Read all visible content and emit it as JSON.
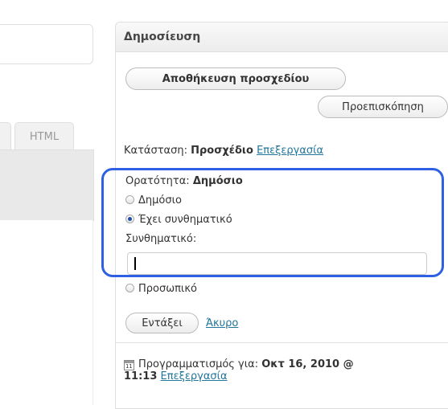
{
  "editor": {
    "html_tab_label": "HTML"
  },
  "publish": {
    "header": "Δημοσίευση",
    "save_draft": "Αποθήκευση προσχεδίου",
    "preview": "Προεπισκόπηση",
    "status_label": "Κατάσταση: ",
    "status_value": "Προσχέδιο",
    "status_edit": "Επεξεργασία",
    "visibility_label": "Ορατότητα: ",
    "visibility_value": "Δημόσιο",
    "options": {
      "public": "Δημόσιο",
      "password": "Έχει συνθηματικό",
      "private": "Προσωπικό"
    },
    "selected_option": "password",
    "password_label": "Συνθηματικό:",
    "password_value": "",
    "ok": "Εντάξει",
    "cancel": "Άκυρο",
    "schedule_label": "Προγραμματισμός για: ",
    "schedule_date": "Οκτ 16, 2010 @",
    "schedule_time": "11:13",
    "schedule_edit": "Επεξεργασία"
  },
  "colors": {
    "highlight": "#2f60e4",
    "link": "#21759b"
  }
}
